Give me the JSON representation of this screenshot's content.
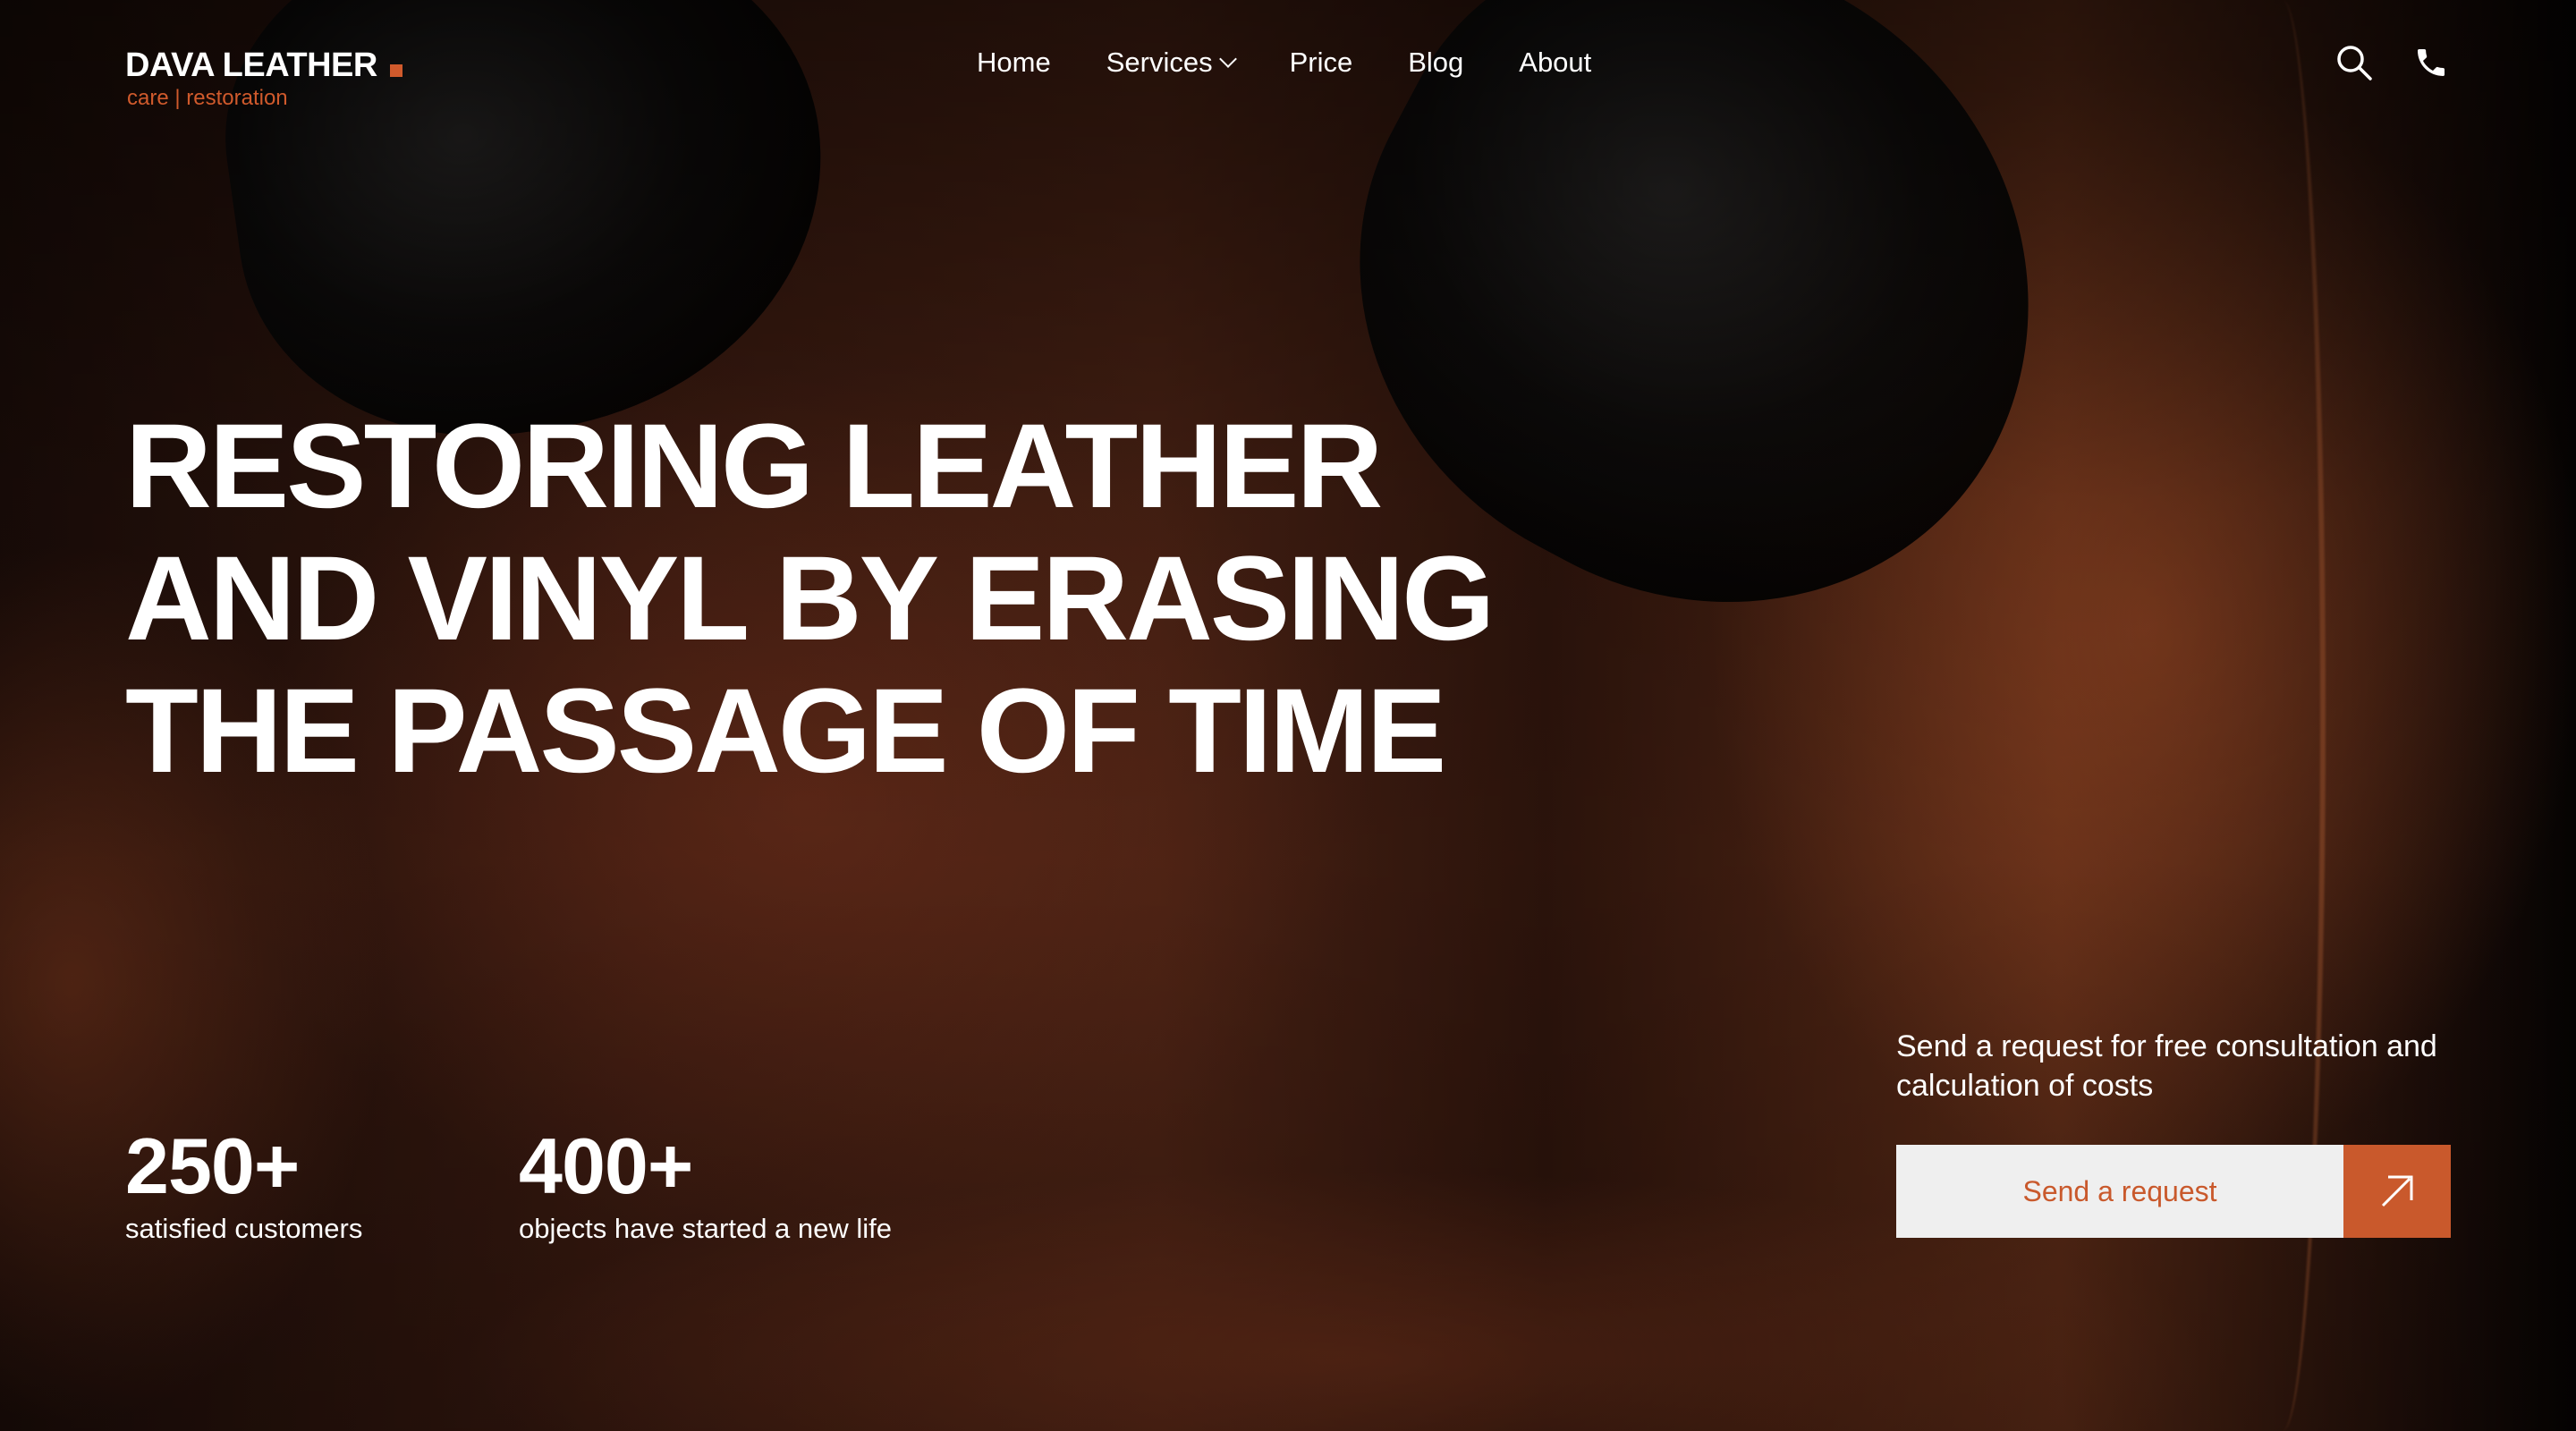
{
  "brand": {
    "name": "DAVA LEATHER",
    "tagline": "care | restoration",
    "accent_color": "#d05a2c"
  },
  "nav": {
    "items": [
      {
        "label": "Home"
      },
      {
        "label": "Services",
        "has_dropdown": true
      },
      {
        "label": "Price"
      },
      {
        "label": "Blog"
      },
      {
        "label": "About"
      }
    ]
  },
  "header_icons": {
    "search": "search-icon",
    "phone": "phone-icon"
  },
  "hero": {
    "title_lines": [
      "RESTORING LEATHER",
      "AND VINYL BY ERASING",
      "THE PASSAGE OF TIME"
    ]
  },
  "stats": [
    {
      "value": "250+",
      "label": "satisfied customers"
    },
    {
      "value": "400+",
      "label": "objects have started a new life"
    }
  ],
  "cta": {
    "text": "Send a request for free consultation and calculation of costs",
    "button_label": "Send a request",
    "arrow_icon": "arrow-up-right-icon",
    "button_bg": "#efefef",
    "accent_color": "#c9592c"
  }
}
